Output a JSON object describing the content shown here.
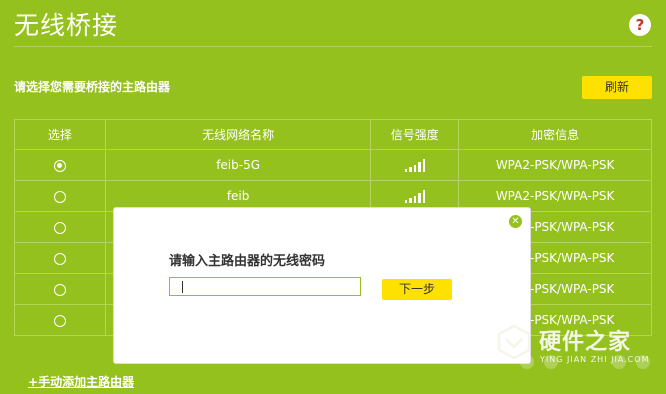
{
  "page": {
    "title": "无线桥接",
    "help_icon": "?"
  },
  "instruction": "请选择您需要桥接的主路由器",
  "refresh_label": "刷新",
  "table": {
    "headers": [
      "选择",
      "无线网络名称",
      "信号强度",
      "加密信息"
    ],
    "rows": [
      {
        "selected": true,
        "ssid": "feib-5G",
        "encryption": "WPA2-PSK/WPA-PSK"
      },
      {
        "selected": false,
        "ssid": "feib",
        "encryption": "WPA2-PSK/WPA-PSK"
      },
      {
        "selected": false,
        "ssid": "",
        "encryption": "WPA2-PSK/WPA-PSK"
      },
      {
        "selected": false,
        "ssid": "",
        "encryption": "WPA2-PSK/WPA-PSK"
      },
      {
        "selected": false,
        "ssid": "",
        "encryption": "WPA2-PSK/WPA-PSK"
      },
      {
        "selected": false,
        "ssid": "",
        "encryption": "WPA2-PSK/WPA-PSK"
      }
    ]
  },
  "add_link": {
    "plus": "+",
    "label": "手动添加主路由器"
  },
  "dialog": {
    "label": "请输入主路由器的无线密码",
    "password_value": "",
    "next_label": "下一步"
  },
  "watermark": {
    "text": "硬件之家",
    "sub": "YING JIAN ZHI JIA.COM"
  },
  "colors": {
    "background": "#95c11f",
    "button": "#ffe100"
  }
}
